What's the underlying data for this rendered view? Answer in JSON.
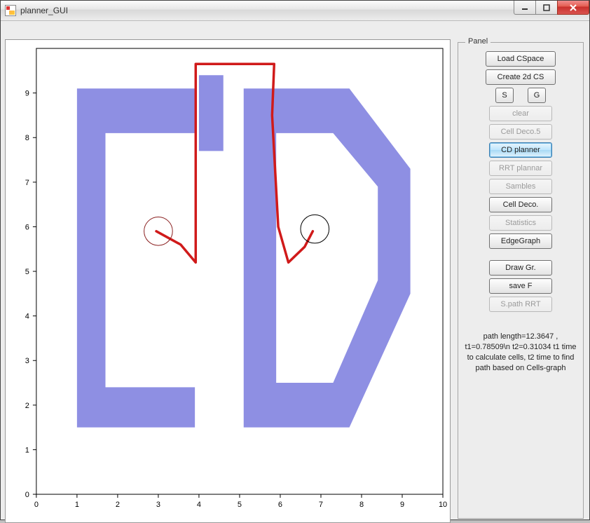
{
  "window": {
    "title": "planner_GUI"
  },
  "panel": {
    "title": "Panel",
    "buttons": {
      "load_cspace": "Load CSpace",
      "create_2d_cs": "Create 2d CS",
      "s": "S",
      "g": "G",
      "clear": "clear",
      "cell_deco_5": "Cell Deco.5",
      "cd_planner": "CD planner",
      "rrt_plannar": "RRT plannar",
      "sambles": "Sambles",
      "cell_deco": "Cell Deco.",
      "statistics": "Statistics",
      "edge_graph": "EdgeGraph",
      "draw_gr": "Draw Gr.",
      "save_f": "save F",
      "spath_rrt": "S.path RRT"
    },
    "info": "path length=12.3647 , t1=0.78509\\n t2=0.31034 t1 time to calculate cells, t2 time to find path based on Cells-graph"
  },
  "chart_data": {
    "type": "map",
    "xlim": [
      0,
      10
    ],
    "ylim": [
      0,
      10
    ],
    "xticks": [
      0,
      1,
      2,
      3,
      4,
      5,
      6,
      7,
      8,
      9,
      10
    ],
    "yticks": [
      0,
      1,
      2,
      3,
      4,
      5,
      6,
      7,
      8,
      9
    ],
    "obstacles": [
      {
        "name": "left-C-shape",
        "points": [
          [
            1.0,
            9.1
          ],
          [
            3.9,
            9.1
          ],
          [
            3.9,
            8.1
          ],
          [
            1.7,
            8.1
          ],
          [
            1.7,
            2.4
          ],
          [
            3.9,
            2.4
          ],
          [
            3.9,
            1.5
          ],
          [
            1.0,
            1.5
          ]
        ]
      },
      {
        "name": "right-D-shape-outer",
        "outer": [
          [
            5.1,
            9.1
          ],
          [
            7.7,
            9.1
          ],
          [
            9.2,
            7.3
          ],
          [
            9.2,
            4.5
          ],
          [
            7.7,
            1.5
          ],
          [
            5.1,
            1.5
          ]
        ],
        "inner": [
          [
            5.9,
            8.1
          ],
          [
            7.3,
            8.1
          ],
          [
            8.4,
            6.9
          ],
          [
            8.4,
            4.8
          ],
          [
            7.3,
            2.5
          ],
          [
            5.9,
            2.5
          ]
        ]
      },
      {
        "name": "gap-bar",
        "points": [
          [
            4.0,
            9.4
          ],
          [
            4.6,
            9.4
          ],
          [
            4.6,
            7.7
          ],
          [
            4.0,
            7.7
          ]
        ]
      }
    ],
    "start": {
      "x": 3.0,
      "y": 5.9,
      "r": 0.35
    },
    "goal": {
      "x": 6.85,
      "y": 5.95,
      "r": 0.35
    },
    "path": [
      [
        2.95,
        5.9
      ],
      [
        3.55,
        5.6
      ],
      [
        3.92,
        5.2
      ],
      [
        3.92,
        9.65
      ],
      [
        5.85,
        9.65
      ],
      [
        5.8,
        8.5
      ],
      [
        5.95,
        6.0
      ],
      [
        6.2,
        5.2
      ],
      [
        6.6,
        5.55
      ],
      [
        6.8,
        5.9
      ]
    ],
    "colors": {
      "obstacle": "#8e8fe3",
      "path": "#d01a1a",
      "circle": "#8a1f1f"
    }
  }
}
